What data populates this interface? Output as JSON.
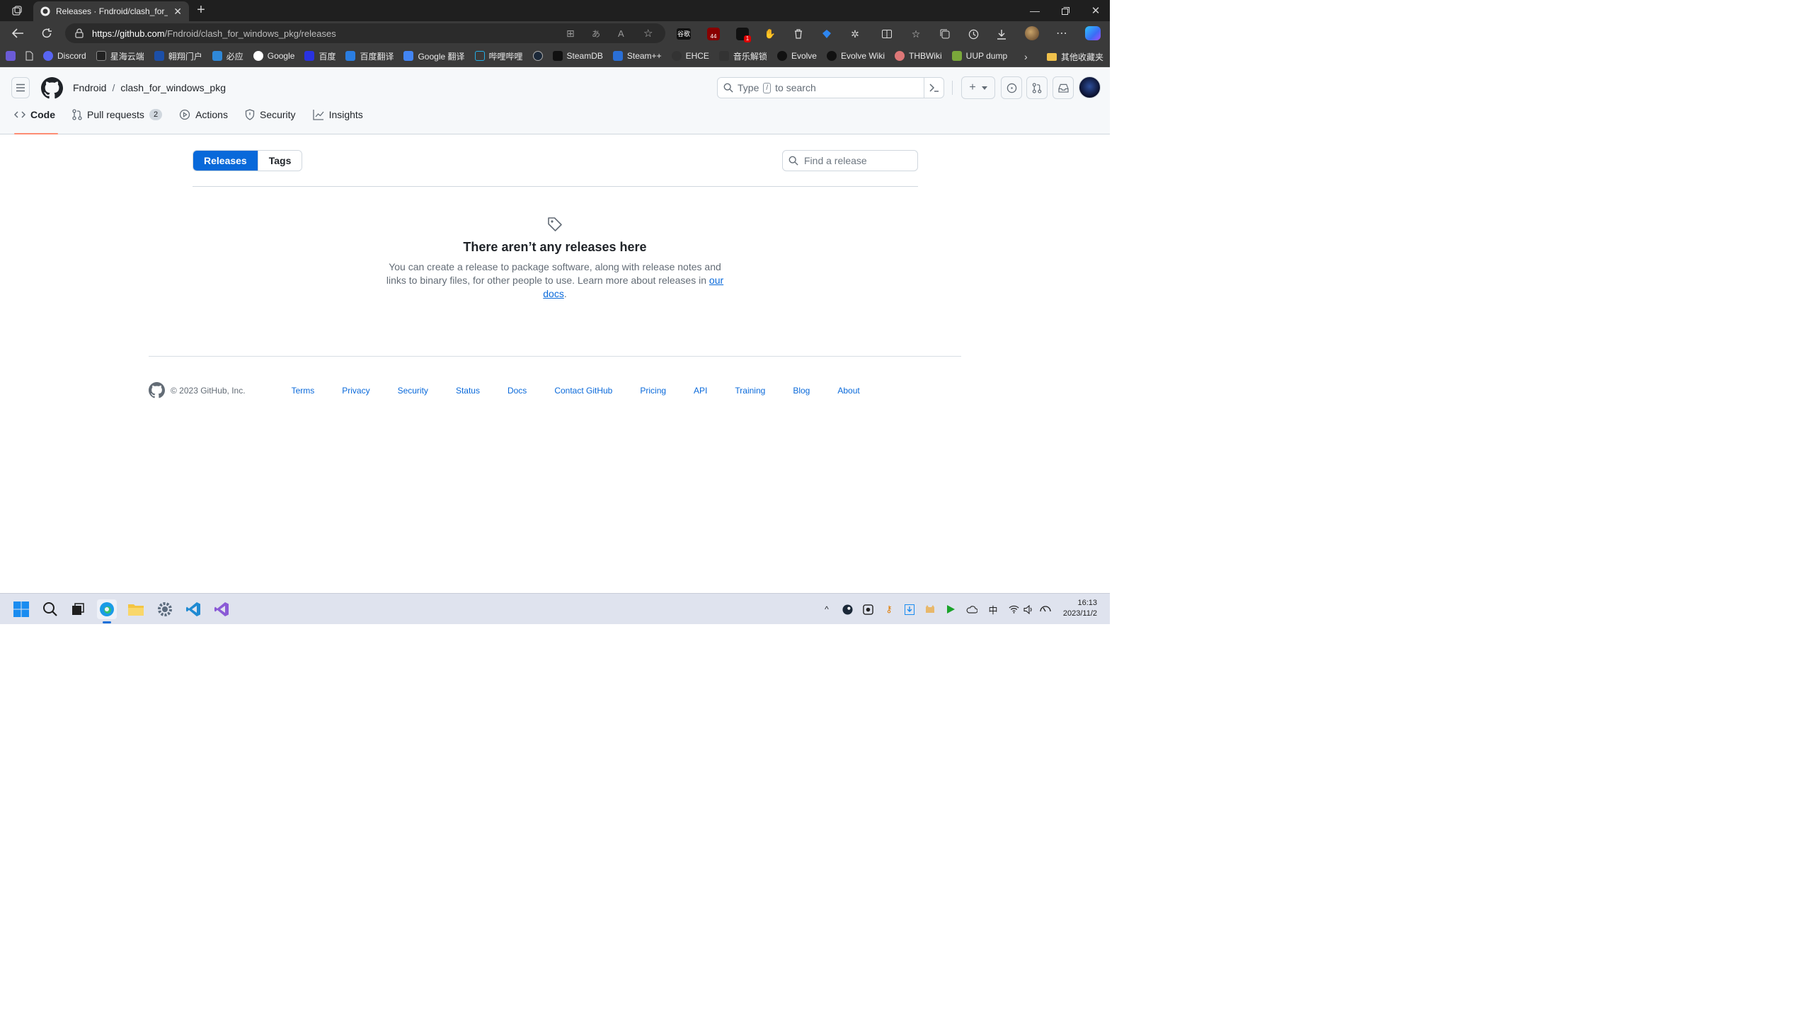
{
  "browser": {
    "tab_title": "Releases · Fndroid/clash_for_wind",
    "url_host": "https://github.com",
    "url_path": "/Fndroid/clash_for_windows_pkg/releases",
    "bookmarks": [
      "Discord",
      "星海云端",
      "翱翔门户",
      "必应",
      "Google",
      "百度",
      "百度翻译",
      "Google 翻译",
      "哔哩哔哩",
      "SteamDB",
      "Steam++",
      "EHCE",
      "音乐解锁",
      "Evolve",
      "Evolve Wiki",
      "THBWiki",
      "UUP dump"
    ],
    "other_bookmarks": "其他收藏夹",
    "ext_badge_1": "44",
    "ext_badge_2": "1",
    "ext_label_gg": "谷歌"
  },
  "github": {
    "owner": "Fndroid",
    "separator": "/",
    "repo": "clash_for_windows_pkg",
    "search_prefix": "Type",
    "search_key": "/",
    "search_suffix": "to search",
    "nav": {
      "code": "Code",
      "pulls": "Pull requests",
      "pulls_count": "2",
      "actions": "Actions",
      "security": "Security",
      "insights": "Insights"
    }
  },
  "releases": {
    "tab_releases": "Releases",
    "tab_tags": "Tags",
    "find_placeholder": "Find a release",
    "empty_title": "There aren’t any releases here",
    "empty_body": "You can create a release to package software, along with release notes and links to binary files, for other people to use. Learn more about releases in ",
    "empty_link_1": "our",
    "empty_link_2": "docs",
    "empty_end": "."
  },
  "footer": {
    "copyright": "© 2023 GitHub, Inc.",
    "links": [
      "Terms",
      "Privacy",
      "Security",
      "Status",
      "Docs",
      "Contact GitHub",
      "Pricing",
      "API",
      "Training",
      "Blog",
      "About"
    ]
  },
  "taskbar": {
    "time": "16:13",
    "date": "2023/11/2",
    "ime": "中"
  },
  "colors": {
    "accent": "#0969da",
    "nav_underline": "#fd8c73"
  }
}
